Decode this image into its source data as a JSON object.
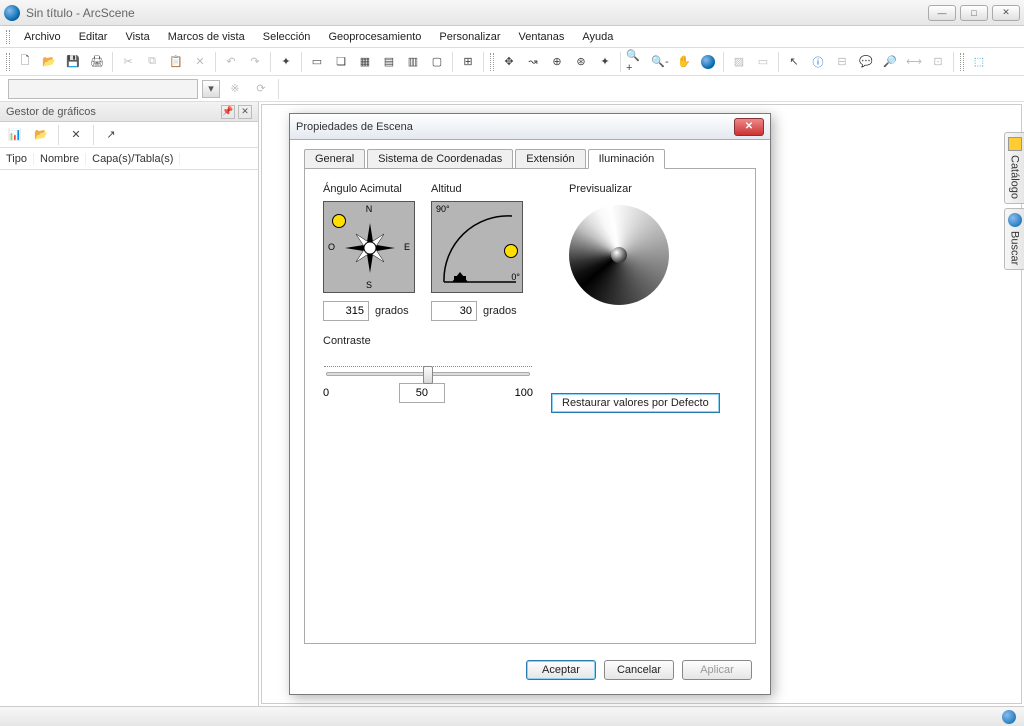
{
  "window": {
    "title": "Sin título - ArcScene"
  },
  "menu": [
    "Archivo",
    "Editar",
    "Vista",
    "Marcos de vista",
    "Selección",
    "Geoprocesamiento",
    "Personalizar",
    "Ventanas",
    "Ayuda"
  ],
  "dock": {
    "title": "Gestor de gráficos",
    "columns": [
      "Tipo",
      "Nombre",
      "Capa(s)/Tabla(s)"
    ]
  },
  "side_tabs": {
    "catalog": "Catálogo",
    "search": "Buscar"
  },
  "dialog": {
    "title": "Propiedades de Escena",
    "tabs": [
      "General",
      "Sistema de Coordenadas",
      "Extensión",
      "Iluminación"
    ],
    "active_tab": 3,
    "illum": {
      "azimuth_label": "Ángulo Acimutal",
      "altitude_label": "Altitud",
      "preview_label": "Previsualizar",
      "azimuth_value": "315",
      "altitude_value": "30",
      "degrees_unit": "grados",
      "contrast_label": "Contraste",
      "contrast_min": "0",
      "contrast_value": "50",
      "contrast_max": "100",
      "restore": "Restaurar valores por Defecto",
      "compass": {
        "n": "N",
        "s": "S",
        "e": "E",
        "o": "O"
      },
      "alt_marks": {
        "deg90": "90°",
        "deg0": "0°"
      }
    },
    "buttons": {
      "ok": "Aceptar",
      "cancel": "Cancelar",
      "apply": "Aplicar"
    }
  }
}
